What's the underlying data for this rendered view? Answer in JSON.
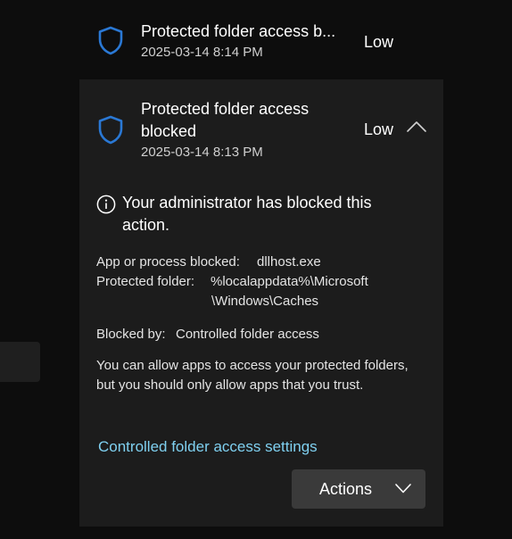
{
  "colors": {
    "background": "#0d0d0d",
    "panel": "#1c1c1c",
    "button": "#3a3a3a",
    "shield": "#2a78d4",
    "link": "#7fd0f0"
  },
  "history": [
    {
      "icon": "shield-icon",
      "title": "Protected folder access b...",
      "time": "2025-03-14 8:14 PM",
      "severity": "Low"
    },
    {
      "icon": "shield-icon",
      "title_line1": "Protected folder access",
      "title_line2": "blocked",
      "time": "2025-03-14 8:13 PM",
      "severity": "Low",
      "expanded": true
    }
  ],
  "details": {
    "info_icon": "info-icon",
    "message": "Your administrator has blocked this action.",
    "app_label": "App or process blocked:",
    "app_value": "dllhost.exe",
    "folder_label": "Protected folder:",
    "folder_value_line1": "%localappdata%\\Microsoft",
    "folder_value_line2": "\\Windows\\Caches",
    "blocked_by_label": "Blocked by:",
    "blocked_by_value": "Controlled folder access",
    "description": "You can allow apps to access your protected folders, but you should only allow apps that you trust.",
    "settings_link": "Controlled folder access settings",
    "actions_label": "Actions"
  }
}
